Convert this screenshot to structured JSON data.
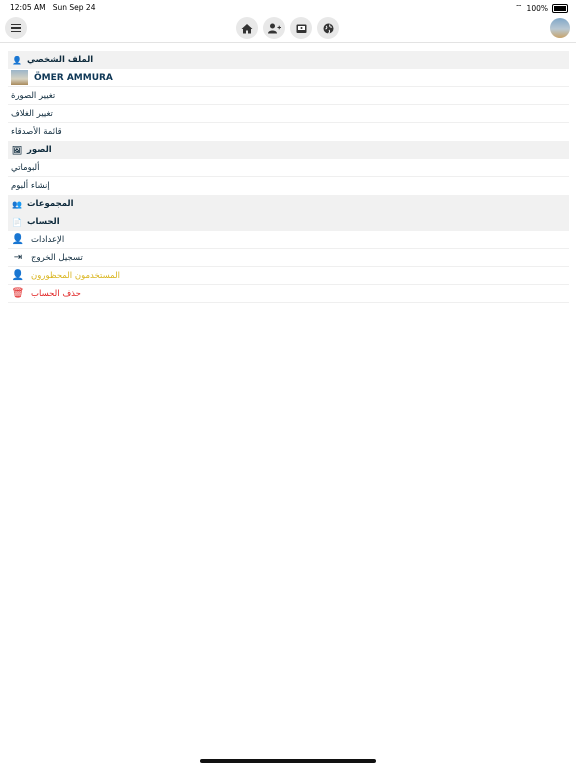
{
  "status_bar": {
    "time": "12:05 AM",
    "date": "Sun Sep 24",
    "battery": "100%"
  },
  "sections": {
    "profile_header": "الملف الشخصي",
    "profile_name": "ÖMER AMMURA",
    "change_photo": "تغيير الصورة",
    "change_cover": "تغيير الغلاف",
    "friends_list": "قائمة الأصدقاء",
    "photos_header": "الصور",
    "my_albums": "ألبوماتي",
    "create_album": "إنشاء ألبوم",
    "groups_header": "المجموعات",
    "account_header": "الحساب",
    "settings": "الإعدادات",
    "logout": "تسجيل الخروج",
    "blocked_users": "المستخدمون المحظورون",
    "delete_account": "حذف الحساب"
  },
  "colors": {
    "text": "#0e2a3c",
    "warning": "#d9b41d",
    "danger": "#e01f1f",
    "header_bg": "#f1f1f1"
  },
  "icons": [
    "menu-icon",
    "home-icon",
    "add-user-icon",
    "messages-icon",
    "globe-icon",
    "user-icon",
    "images-icon",
    "users-icon",
    "document-icon",
    "user-settings-icon",
    "logout-icon",
    "blocked-user-icon",
    "trash-icon"
  ]
}
